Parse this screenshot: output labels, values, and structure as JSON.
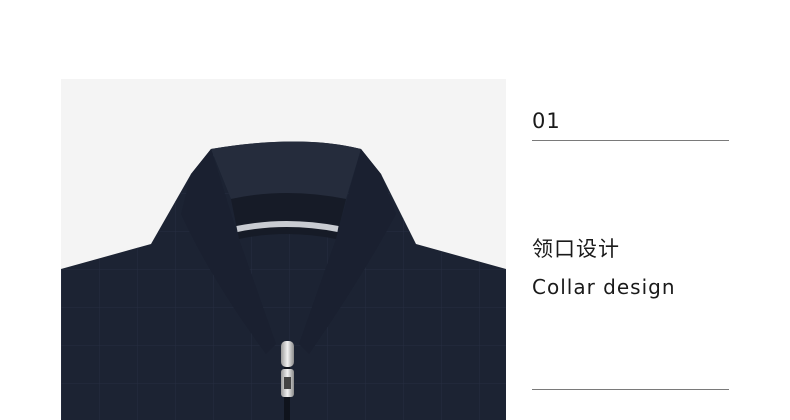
{
  "section": {
    "index": "01",
    "title_cn": "领口设计",
    "title_en": "Collar design"
  },
  "colors": {
    "photo_background": "#f4f4f4",
    "jacket_navy": "#1c2333",
    "text": "#1a1a1a",
    "rule": "#7a7a7a"
  },
  "image": {
    "icon": "jacket-collar-photo"
  }
}
